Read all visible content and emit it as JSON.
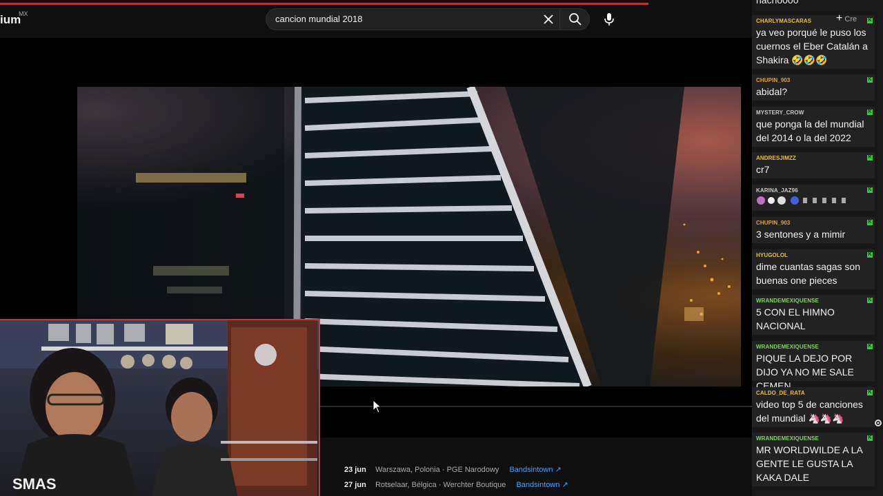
{
  "header": {
    "logo_text": "ium",
    "logo_region": "MX",
    "search_query": "cancion mundial 2018",
    "clear_icon": "close-icon",
    "search_icon": "search-icon",
    "mic_icon": "mic-icon",
    "create_label": "Cre"
  },
  "video": {
    "description_icon": "skyscraper-night-scene"
  },
  "tour_dates": [
    {
      "date": "23 jun",
      "venue": "Warszawa, Polonia · PGE Narodowy",
      "link": "Bandsintown",
      "icon": "external-link-icon"
    },
    {
      "date": "27 jun",
      "venue": "Rotselaar, Bélgica · Werchter Boutique",
      "link": "Bandsintown",
      "icon": "external-link-icon"
    }
  ],
  "chat": {
    "top_partial": "nacho000",
    "messages": [
      {
        "user": "CHARLYMASCARAS",
        "color": "#e5c33a",
        "text": "ya veo porqué le puso los cuernos el Eber Catalán a Shakira 🤣🤣🤣"
      },
      {
        "user": "CHUPIN_903",
        "color": "#e5a13a",
        "text": "abidal?"
      },
      {
        "user": "MYSTERY_CROW",
        "color": "#c9c9c9",
        "text": "que ponga la del mundial del 2014 o la del 2022"
      },
      {
        "user": "ANDRESJIMZZ",
        "color": "#e5c33a",
        "text": "cr7"
      },
      {
        "user": "KARINA_JAZ96",
        "color": "#c9c9c9",
        "text": "emotes"
      },
      {
        "user": "CHUPIN_903",
        "color": "#e5a13a",
        "text": "3 sentones y a mimir"
      },
      {
        "user": "HYUGOLOL",
        "color": "#e5c33a",
        "text": "dime cuantas sagas son buenas one pieces"
      },
      {
        "user": "WRANDEMEXIQUENSE",
        "color": "#7ed957",
        "text": "5 CON EL HIMNO NACIONAL"
      },
      {
        "user": "WRANDEMEXIQUENSE",
        "color": "#7ed957",
        "text": "PIQUE LA DEJO POR DIJO YA NO ME SALE CEMEN"
      },
      {
        "user": "CALDO_DE_RATA",
        "color": "#e5c33a",
        "text": "video top 5 de canciones del mundial 🦄🦄🦄"
      },
      {
        "user": "WRANDEMEXIQUENSE",
        "color": "#7ed957",
        "text": "MR WORLDWILDE A LA GENTE LE GUSTA LA KAKA DALE"
      }
    ],
    "badge_label": "K"
  },
  "colors": {
    "accent_red": "#c4302b",
    "link_blue": "#3ea6ff",
    "chat_bg": "#181818",
    "msg_bg": "#222222"
  }
}
